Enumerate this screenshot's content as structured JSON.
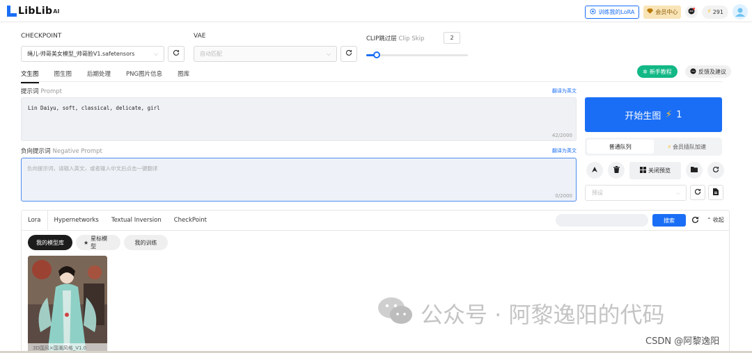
{
  "brand": {
    "logo_text": "LibLib",
    "logo_sup": "AI"
  },
  "topbar": {
    "train_lora": "训练我的LoRA",
    "member_center": "会员中心",
    "points": "291"
  },
  "checkpoint": {
    "label": "CHECKPOINT",
    "value": "绳儿-帅哥美女模型_帅哥脸V1.safetensors"
  },
  "vae": {
    "label": "VAE",
    "placeholder": "自动匹配"
  },
  "clip": {
    "label": "CLIP跳过层",
    "label_en": "Clip Skip",
    "value": "2",
    "slider_fraction": 0.1
  },
  "tabs": [
    "文生图",
    "图生图",
    "后期处理",
    "PNG图片信息",
    "图库"
  ],
  "guide_button": "新手教程",
  "feedback_button": "反馈及建议",
  "prompt": {
    "label": "提示词",
    "label_en": "Prompt",
    "translate": "翻译为英文",
    "text": "Lin Daiyu, soft, classical, delicate, girl",
    "counter": "42/2000"
  },
  "negative_prompt": {
    "label": "负向提示词",
    "label_en": "Negative Prompt",
    "translate": "翻译为英文",
    "placeholder": "负向提示词，请输入英文，或者输入中文后点击一键翻译",
    "counter": "0/2000"
  },
  "generate": {
    "label": "开始生图",
    "cost": "1"
  },
  "queue": {
    "normal": "普通队列",
    "member": "会员插队加速"
  },
  "close_preview": "关闭预览",
  "preset": {
    "placeholder": "预设"
  },
  "model_panel": {
    "tabs": [
      "Lora",
      "Hypernetworks",
      "Textual Inversion",
      "CheckPoint"
    ],
    "search_button": "搜索",
    "collapse": "收起",
    "filters": [
      "我的模型库",
      "星标模型",
      "我的训练"
    ],
    "card_caption": "3D国风×国潮风格_V1.0"
  },
  "watermark": {
    "text": "公众号 · 阿黎逸阳的代码",
    "csdn": "CSDN @阿黎逸阳"
  },
  "colors": {
    "accent": "#1a6ef5",
    "green": "#12b886",
    "dark_pill": "#1c1c1c"
  }
}
